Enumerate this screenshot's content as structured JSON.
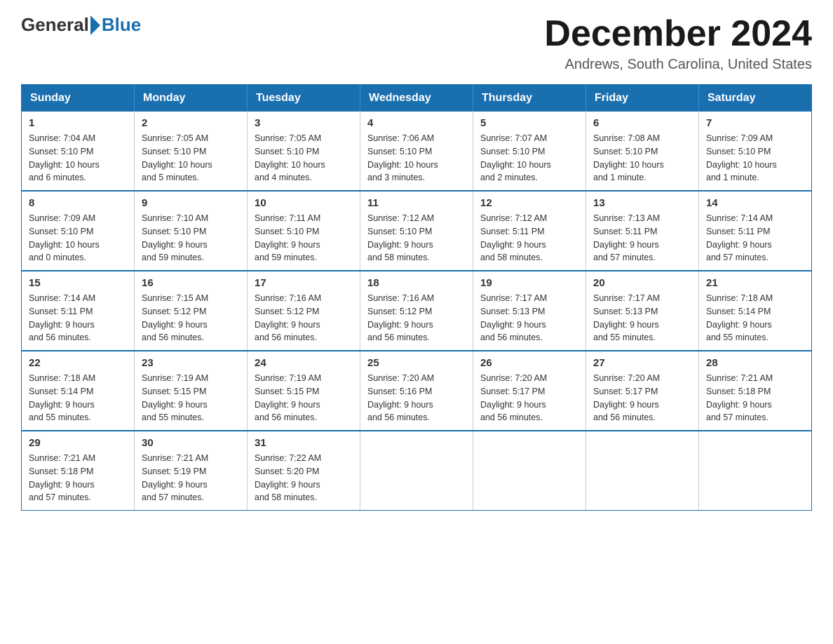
{
  "header": {
    "logo": {
      "part1": "General",
      "part2": "Blue"
    },
    "month_title": "December 2024",
    "location": "Andrews, South Carolina, United States"
  },
  "calendar": {
    "days_of_week": [
      "Sunday",
      "Monday",
      "Tuesday",
      "Wednesday",
      "Thursday",
      "Friday",
      "Saturday"
    ],
    "weeks": [
      [
        {
          "day": "1",
          "info": "Sunrise: 7:04 AM\nSunset: 5:10 PM\nDaylight: 10 hours\nand 6 minutes."
        },
        {
          "day": "2",
          "info": "Sunrise: 7:05 AM\nSunset: 5:10 PM\nDaylight: 10 hours\nand 5 minutes."
        },
        {
          "day": "3",
          "info": "Sunrise: 7:05 AM\nSunset: 5:10 PM\nDaylight: 10 hours\nand 4 minutes."
        },
        {
          "day": "4",
          "info": "Sunrise: 7:06 AM\nSunset: 5:10 PM\nDaylight: 10 hours\nand 3 minutes."
        },
        {
          "day": "5",
          "info": "Sunrise: 7:07 AM\nSunset: 5:10 PM\nDaylight: 10 hours\nand 2 minutes."
        },
        {
          "day": "6",
          "info": "Sunrise: 7:08 AM\nSunset: 5:10 PM\nDaylight: 10 hours\nand 1 minute."
        },
        {
          "day": "7",
          "info": "Sunrise: 7:09 AM\nSunset: 5:10 PM\nDaylight: 10 hours\nand 1 minute."
        }
      ],
      [
        {
          "day": "8",
          "info": "Sunrise: 7:09 AM\nSunset: 5:10 PM\nDaylight: 10 hours\nand 0 minutes."
        },
        {
          "day": "9",
          "info": "Sunrise: 7:10 AM\nSunset: 5:10 PM\nDaylight: 9 hours\nand 59 minutes."
        },
        {
          "day": "10",
          "info": "Sunrise: 7:11 AM\nSunset: 5:10 PM\nDaylight: 9 hours\nand 59 minutes."
        },
        {
          "day": "11",
          "info": "Sunrise: 7:12 AM\nSunset: 5:10 PM\nDaylight: 9 hours\nand 58 minutes."
        },
        {
          "day": "12",
          "info": "Sunrise: 7:12 AM\nSunset: 5:11 PM\nDaylight: 9 hours\nand 58 minutes."
        },
        {
          "day": "13",
          "info": "Sunrise: 7:13 AM\nSunset: 5:11 PM\nDaylight: 9 hours\nand 57 minutes."
        },
        {
          "day": "14",
          "info": "Sunrise: 7:14 AM\nSunset: 5:11 PM\nDaylight: 9 hours\nand 57 minutes."
        }
      ],
      [
        {
          "day": "15",
          "info": "Sunrise: 7:14 AM\nSunset: 5:11 PM\nDaylight: 9 hours\nand 56 minutes."
        },
        {
          "day": "16",
          "info": "Sunrise: 7:15 AM\nSunset: 5:12 PM\nDaylight: 9 hours\nand 56 minutes."
        },
        {
          "day": "17",
          "info": "Sunrise: 7:16 AM\nSunset: 5:12 PM\nDaylight: 9 hours\nand 56 minutes."
        },
        {
          "day": "18",
          "info": "Sunrise: 7:16 AM\nSunset: 5:12 PM\nDaylight: 9 hours\nand 56 minutes."
        },
        {
          "day": "19",
          "info": "Sunrise: 7:17 AM\nSunset: 5:13 PM\nDaylight: 9 hours\nand 56 minutes."
        },
        {
          "day": "20",
          "info": "Sunrise: 7:17 AM\nSunset: 5:13 PM\nDaylight: 9 hours\nand 55 minutes."
        },
        {
          "day": "21",
          "info": "Sunrise: 7:18 AM\nSunset: 5:14 PM\nDaylight: 9 hours\nand 55 minutes."
        }
      ],
      [
        {
          "day": "22",
          "info": "Sunrise: 7:18 AM\nSunset: 5:14 PM\nDaylight: 9 hours\nand 55 minutes."
        },
        {
          "day": "23",
          "info": "Sunrise: 7:19 AM\nSunset: 5:15 PM\nDaylight: 9 hours\nand 55 minutes."
        },
        {
          "day": "24",
          "info": "Sunrise: 7:19 AM\nSunset: 5:15 PM\nDaylight: 9 hours\nand 56 minutes."
        },
        {
          "day": "25",
          "info": "Sunrise: 7:20 AM\nSunset: 5:16 PM\nDaylight: 9 hours\nand 56 minutes."
        },
        {
          "day": "26",
          "info": "Sunrise: 7:20 AM\nSunset: 5:17 PM\nDaylight: 9 hours\nand 56 minutes."
        },
        {
          "day": "27",
          "info": "Sunrise: 7:20 AM\nSunset: 5:17 PM\nDaylight: 9 hours\nand 56 minutes."
        },
        {
          "day": "28",
          "info": "Sunrise: 7:21 AM\nSunset: 5:18 PM\nDaylight: 9 hours\nand 57 minutes."
        }
      ],
      [
        {
          "day": "29",
          "info": "Sunrise: 7:21 AM\nSunset: 5:18 PM\nDaylight: 9 hours\nand 57 minutes."
        },
        {
          "day": "30",
          "info": "Sunrise: 7:21 AM\nSunset: 5:19 PM\nDaylight: 9 hours\nand 57 minutes."
        },
        {
          "day": "31",
          "info": "Sunrise: 7:22 AM\nSunset: 5:20 PM\nDaylight: 9 hours\nand 58 minutes."
        },
        null,
        null,
        null,
        null
      ]
    ]
  }
}
